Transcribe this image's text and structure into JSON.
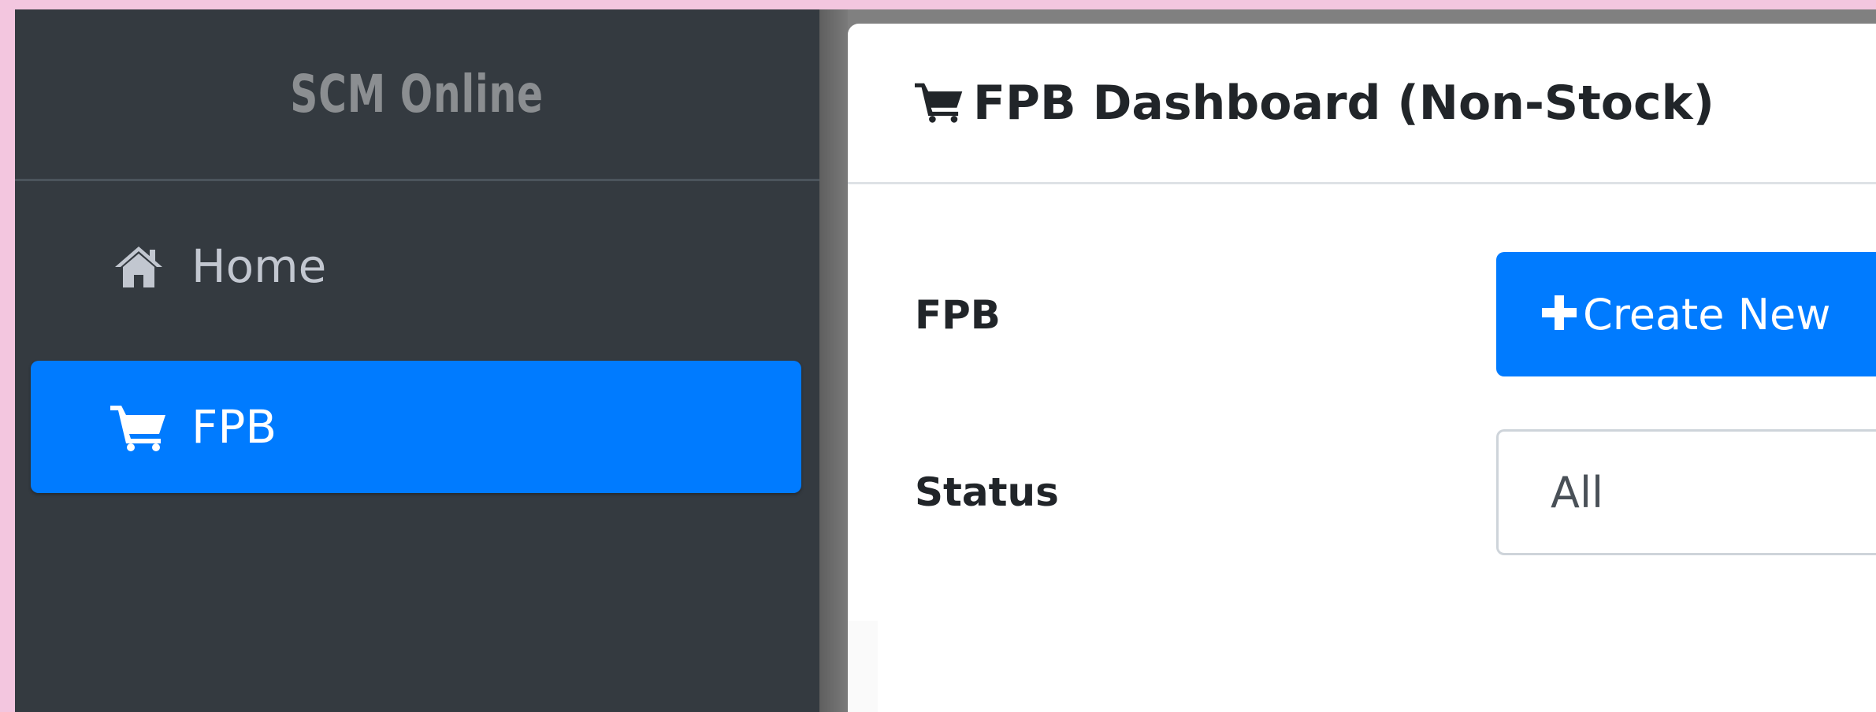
{
  "sidebar": {
    "brand": "SCM Online",
    "items": [
      {
        "label": "Home",
        "icon": "home-icon",
        "active": false
      },
      {
        "label": "FPB",
        "icon": "shopping-cart-icon",
        "active": true
      }
    ]
  },
  "main": {
    "title": "FPB Dashboard (Non-Stock)",
    "title_icon": "shopping-cart-icon",
    "fpb_label": "FPB",
    "create_button_label": "Create New",
    "create_button_icon": "plus-icon",
    "status_label": "Status",
    "status_selected": "All"
  },
  "colors": {
    "background": "#f3c6df",
    "sidebar": "#343a40",
    "accent": "#007bff",
    "sidebar_text": "#c2c7d0",
    "brand_text": "#8b8e91"
  }
}
